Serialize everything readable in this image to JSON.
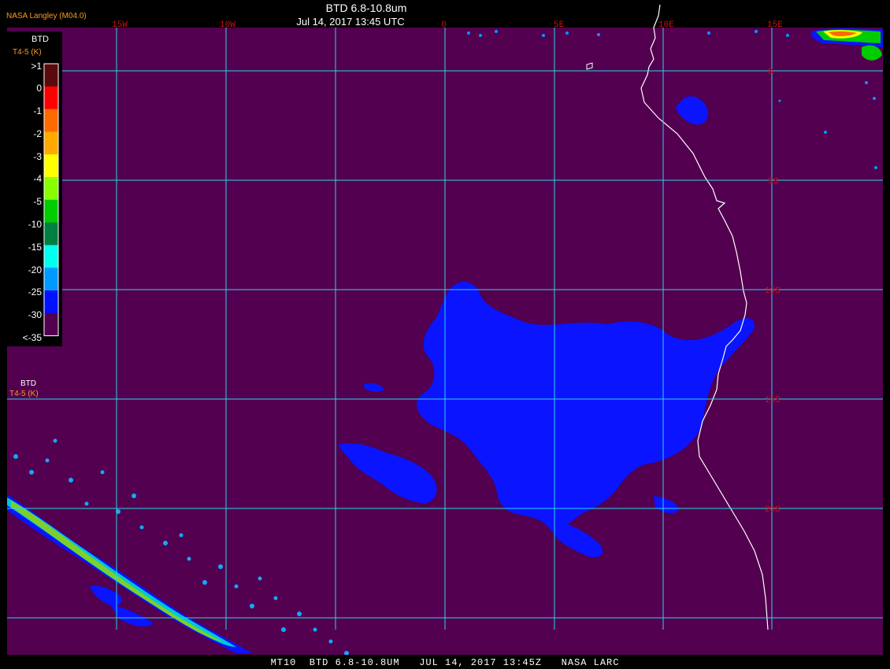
{
  "header": {
    "credit": "NASA Langley (M04.0)",
    "title": "BTD 6.8-10.8um",
    "datetime": "Jul 14, 2017 13:45 UTC"
  },
  "footer": {
    "text": "MT10  BTD 6.8-10.8UM   JUL 14, 2017 13:45Z   NASA LARC"
  },
  "legend": {
    "title": "BTD",
    "subtitle": "T4-5 (K)",
    "labels": [
      ">1",
      "0",
      "-1",
      "-2",
      "-3",
      "-4",
      "-5",
      "-10",
      "-15",
      "-20",
      "-25",
      "-30",
      "<-35"
    ],
    "colors": [
      "#5a0a0a",
      "#ff0000",
      "#ff6a00",
      "#ffaa00",
      "#ffff00",
      "#88ff00",
      "#00cc00",
      "#008040",
      "#00ffee",
      "#0099ff",
      "#0011ff",
      "#52004f"
    ]
  },
  "legend_repeat": {
    "title": "BTD",
    "subtitle": "T4-5 (K)"
  },
  "map": {
    "background_color": "#52004f",
    "grid_color": "#2ad6e8",
    "grid_label_color": "#d01010",
    "longitude_labels": [
      "15W",
      "10W",
      "0",
      "5E",
      "10E",
      "15E"
    ],
    "latitude_labels": [
      "0",
      "5S",
      "10S",
      "15S",
      "20S"
    ],
    "features": [
      "coastline-west-africa",
      "low-cloud-deck-blue",
      "frontal-band-southwest",
      "convection-northeast"
    ]
  },
  "colors": {
    "accent": "#ff9a1e",
    "text": "#ffffff",
    "background": "#000000"
  }
}
